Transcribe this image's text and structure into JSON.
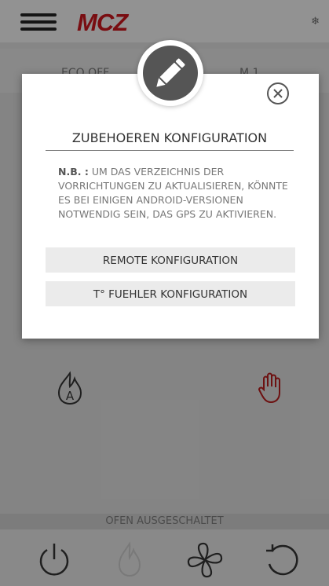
{
  "header": {
    "logo": "MCZ"
  },
  "modes": {
    "left_label": "ECO OFF",
    "right_label": "M 1"
  },
  "status": {
    "text": "OFEN AUSGESCHALTET"
  },
  "modal": {
    "title": "ZUBEHOEREN KONFIGURATION",
    "note_prefix": "N.B. :",
    "note_text": " UM DAS VERZEICHNIS DER VORRICHTUNGEN ZU AKTUALISIEREN, KÖNNTE ES BEI EINIGEN ANDROID-VERSIONEN NOTWENDIG SEIN, DAS GPS ZU AKTIVIEREN.",
    "buttons": [
      {
        "label": "REMOTE KONFIGURATION"
      },
      {
        "label": "T° FUEHLER KONFIGURATION"
      }
    ]
  },
  "colors": {
    "brand": "#c4161c",
    "accent_red": "#b01c1c",
    "overlay": "rgba(0,0,0,0.38)"
  }
}
